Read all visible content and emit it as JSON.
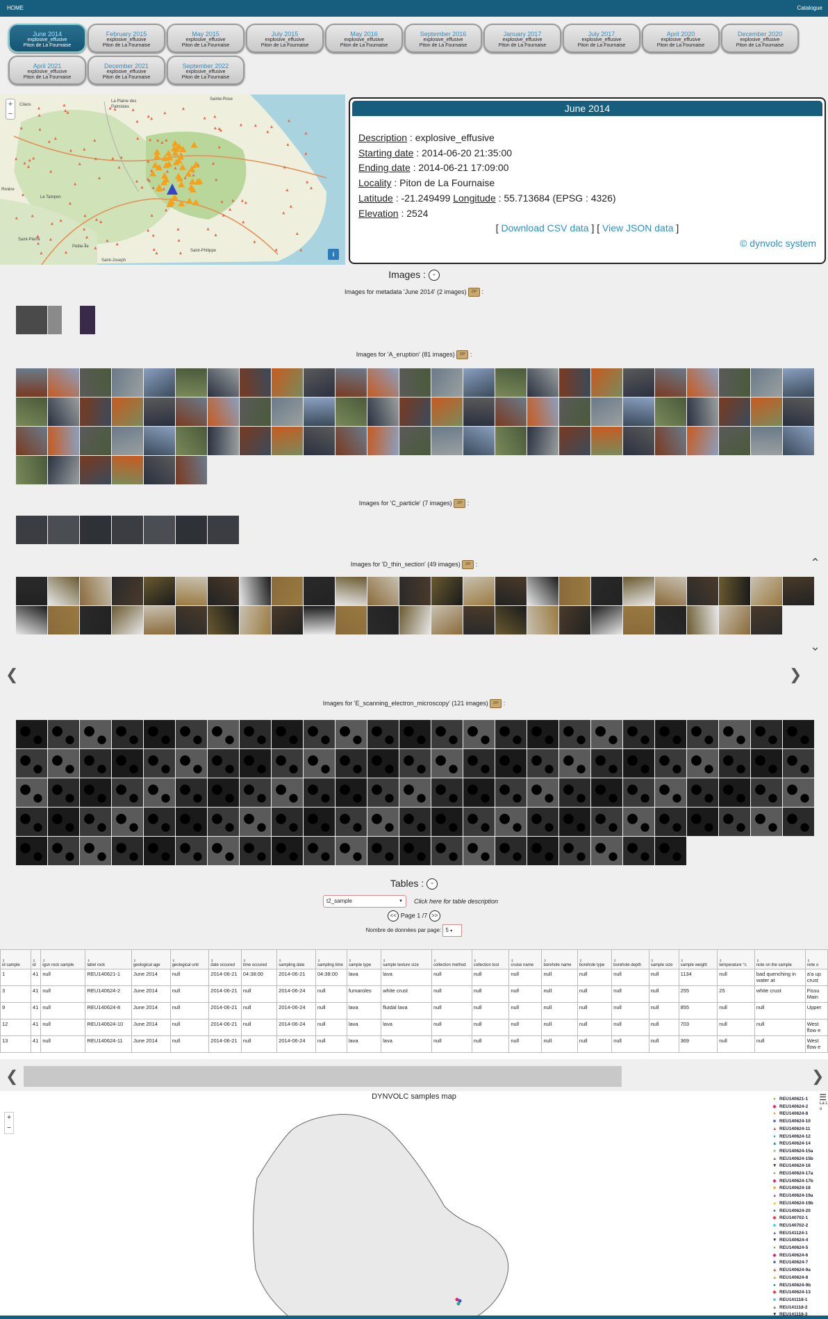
{
  "topbar": {
    "home": "HOME",
    "catalogue": "Catalogue"
  },
  "events": [
    {
      "title": "June 2014",
      "type": "explosive_effusive",
      "place": "Piton de La Fournaise"
    },
    {
      "title": "February 2015",
      "type": "explosive_effusive",
      "place": "Piton de La Fournaise"
    },
    {
      "title": "May 2015",
      "type": "explosive_effusive",
      "place": "Piton de La Fournaise"
    },
    {
      "title": "July 2015",
      "type": "explosive_effusive",
      "place": "Piton de La Fournaise"
    },
    {
      "title": "May 2016",
      "type": "explosive_effusive",
      "place": "Piton de La Fournaise"
    },
    {
      "title": "September 2016",
      "type": "explosive_effusive",
      "place": "Piton de La Fournaise"
    },
    {
      "title": "January 2017",
      "type": "explosive_effusive",
      "place": "Piton de La Fournaise"
    },
    {
      "title": "July 2017",
      "type": "explosive_effusive",
      "place": "Piton de La Fournaise"
    },
    {
      "title": "April 2020",
      "type": "explosive_effusive",
      "place": "Piton de La Fournaise"
    },
    {
      "title": "December 2020",
      "type": "explosive_effusive",
      "place": "Piton de La Fournaise"
    },
    {
      "title": "April 2021",
      "type": "explosive_effusive",
      "place": "Piton de La Fournaise"
    },
    {
      "title": "December 2021",
      "type": "explosive_effusive",
      "place": "Piton de La Fournaise"
    },
    {
      "title": "September 2022",
      "type": "explosive_effusive",
      "place": "Piton de La Fournaise"
    }
  ],
  "map1": {
    "zoom_in": "+",
    "zoom_out": "−",
    "info": "i",
    "places": [
      "Cilaos",
      "La Plaine des Palmistes",
      "Sainte-Rose",
      "Le Tampon",
      "Rivière",
      "Saint-Pierre",
      "Petite-Île",
      "Saint-Philippe",
      "Saint-Joseph"
    ]
  },
  "info": {
    "title": "June 2014",
    "desc_label": "Description",
    "desc": " : explosive_effusive",
    "start_label": "Starting date",
    "start": " : 2014-06-20 21:35:00",
    "end_label": "Ending date",
    "end": " : 2014-06-21 17:09:00",
    "loc_label": "Locality",
    "loc": " : Piton de La Fournaise",
    "lat_label": "Latitude",
    "lat": " : -21.249499 ",
    "lon_label": "Longitude",
    "lon": " : 55.713684 (EPSG : 4326)",
    "elev_label": "Elevation",
    "elev": " : 2524",
    "csv": "Download CSV data",
    "json": "View JSON data",
    "bracket_open": "[ ",
    "bracket_mid": " ] [ ",
    "bracket_close": " ]",
    "credit": "© dynvolc system"
  },
  "images": {
    "heading": "Images :",
    "toggle": "-",
    "zip": "ZIP",
    "groups": [
      {
        "label": "Images for metadata 'June 2014' (2 images)",
        "suffix": " :",
        "count": 3
      },
      {
        "label": "Images for 'A_eruption' (81 images)",
        "suffix": " :",
        "count": 81
      },
      {
        "label": "Images for 'C_particle' (7 images)",
        "suffix": " :",
        "count": 7
      },
      {
        "label": "Images for 'D_thin_section' (49 images)",
        "suffix": " :",
        "count": 49
      },
      {
        "label": "Images for 'E_scanning_electron_microscopy' (121 images)",
        "suffix": " :",
        "count": 121
      }
    ]
  },
  "tables": {
    "heading": "Tables :",
    "toggle": "-",
    "select": "t2_sample",
    "describe": "Click here for table description",
    "prev": "<<",
    "page": "Page 1 /7",
    "next": ">>",
    "perpage_label": "Nombre de données par page:",
    "perpage": "5",
    "columns": [
      "id sample",
      "id",
      "igsn rock sample",
      "label rock",
      "geological age",
      "geological unit",
      "date occured",
      "time occured",
      "sampling date",
      "sampling time",
      "sample type",
      "sample texture size",
      "collection method",
      "collection tool",
      "cruise name",
      "borehole name",
      "borehole type",
      "borehole depth",
      "sample size",
      "sample weight",
      "temperature °c",
      "note on the sample",
      "note o"
    ],
    "rows": [
      [
        "1",
        "41",
        "null",
        "REU140621-1",
        "June 2014",
        "null",
        "2014-06-21",
        "04:38:00",
        "2014-06-21",
        "04:38:00",
        "lava",
        "lava",
        "null",
        "null",
        "null",
        "null",
        "null",
        "null",
        "null",
        "1134",
        "null",
        "bad quenching in water at",
        "a'a up crust"
      ],
      [
        "3",
        "41",
        "null",
        "REU140624-2",
        "June 2014",
        "null",
        "2014-06-21",
        "null",
        "2014-06-24",
        "null",
        "fumaroles",
        "white crust",
        "null",
        "null",
        "null",
        "null",
        "null",
        "null",
        "null",
        "255",
        "25",
        "white crust",
        "Fissu Main"
      ],
      [
        "9",
        "41",
        "null",
        "REU140624-8",
        "June 2014",
        "null",
        "2014-06-21",
        "null",
        "2014-06-24",
        "null",
        "lava",
        "fluidal lava",
        "null",
        "null",
        "null",
        "null",
        "null",
        "null",
        "null",
        "855",
        "null",
        "null",
        "Upper"
      ],
      [
        "12",
        "41",
        "null",
        "REU140624-10",
        "June 2014",
        "null",
        "2014-06-21",
        "null",
        "2014-06-24",
        "null",
        "lava",
        "lava",
        "null",
        "null",
        "null",
        "null",
        "null",
        "null",
        "null",
        "703",
        "null",
        "null",
        "West flow e"
      ],
      [
        "13",
        "41",
        "null",
        "REU140624-11",
        "June 2014",
        "null",
        "2014-06-21",
        "null",
        "2014-06-24",
        "null",
        "lava",
        "lava",
        "null",
        "null",
        "null",
        "null",
        "null",
        "null",
        "null",
        "369",
        "null",
        "null",
        "West flow e"
      ]
    ]
  },
  "samples_map": {
    "title": "DYNVOLC samples map",
    "zoom_in": "+",
    "zoom_out": "−",
    "menu": "☰",
    "legend_header": "La Lo",
    "legend": [
      {
        "label": "REU140621-1",
        "color": "#7cb342",
        "mark": "●"
      },
      {
        "label": "REU140624-2",
        "color": "#e91e63",
        "mark": "◆"
      },
      {
        "label": "REU140624-8",
        "color": "#ff9800",
        "mark": "●"
      },
      {
        "label": "REU140624-10",
        "color": "#3f51b5",
        "mark": "■"
      },
      {
        "label": "REU140624-11",
        "color": "#f44336",
        "mark": "▲"
      },
      {
        "label": "REU140624-12",
        "color": "#26a69a",
        "mark": "●"
      },
      {
        "label": "REU140624-14",
        "color": "#00897b",
        "mark": "▲"
      },
      {
        "label": "REU140624-15a",
        "color": "#9ccc65",
        "mark": "■"
      },
      {
        "label": "REU140624-15b",
        "color": "#8d6e63",
        "mark": "▲"
      },
      {
        "label": "REU140624-16",
        "color": "#222222",
        "mark": "▼"
      },
      {
        "label": "REU140624-17a",
        "color": "#7cb342",
        "mark": "●"
      },
      {
        "label": "REU140624-17b",
        "color": "#e91e63",
        "mark": "◆"
      },
      {
        "label": "REU140624-18",
        "color": "#ff9800",
        "mark": "■"
      },
      {
        "label": "REU140624-19a",
        "color": "#ab47bc",
        "mark": "▲"
      },
      {
        "label": "REU140624-19b",
        "color": "#fbc02d",
        "mark": "▲"
      },
      {
        "label": "REU140624-20",
        "color": "#0277bd",
        "mark": "●"
      },
      {
        "label": "REU140702-1",
        "color": "#e53935",
        "mark": "◆"
      },
      {
        "label": "REU140702-2",
        "color": "#26c6da",
        "mark": "■"
      },
      {
        "label": "REU141124-1",
        "color": "#5c6bc0",
        "mark": "▲"
      },
      {
        "label": "REU140624-4",
        "color": "#222222",
        "mark": "▼"
      },
      {
        "label": "REU140624-5",
        "color": "#7cb342",
        "mark": "●"
      },
      {
        "label": "REU140624-6",
        "color": "#e91e63",
        "mark": "◆"
      },
      {
        "label": "REU140624-7",
        "color": "#3f51b5",
        "mark": "■"
      },
      {
        "label": "REU140624-9a",
        "color": "#f44336",
        "mark": "▲"
      },
      {
        "label": "REU140624-8",
        "color": "#ff9800",
        "mark": "▲"
      },
      {
        "label": "REU140624-9b",
        "color": "#00897b",
        "mark": "●"
      },
      {
        "label": "REU140624-13",
        "color": "#e53935",
        "mark": "◆"
      },
      {
        "label": "REU141118-1",
        "color": "#26c6da",
        "mark": "■"
      },
      {
        "label": "REU141118-2",
        "color": "#8d6e63",
        "mark": "▲"
      },
      {
        "label": "REU141118-3",
        "color": "#222222",
        "mark": "▼"
      }
    ]
  },
  "colors": {
    "brand": "#175e7e",
    "link": "#2b90c8"
  }
}
